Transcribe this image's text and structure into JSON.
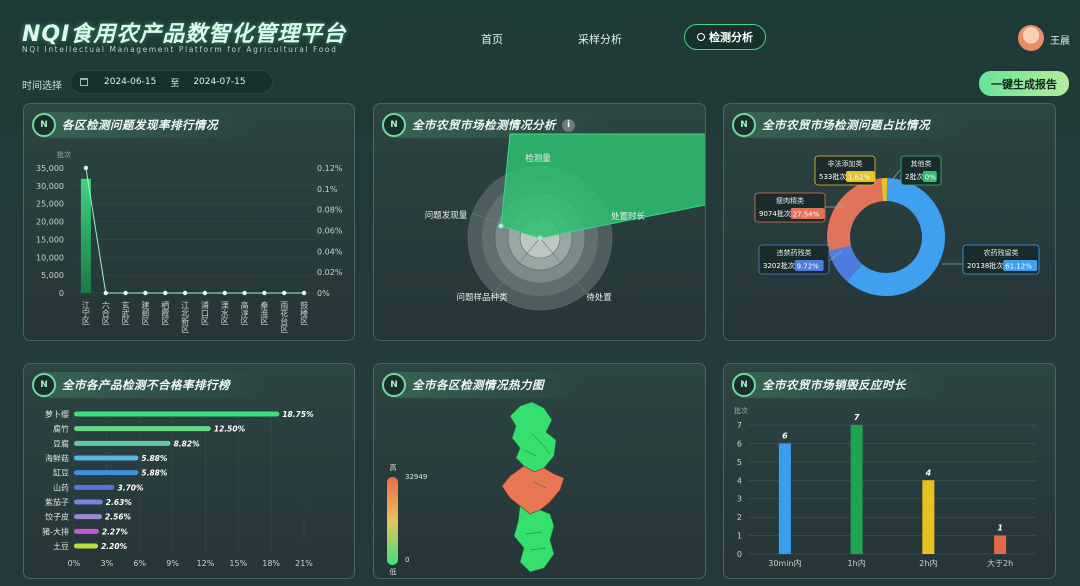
{
  "header": {
    "title": "NQI食用农产品数智化管理平台",
    "subtitle": "NQI Intellectual Management Platform for Agricultural Food",
    "nav": [
      {
        "label": "首页"
      },
      {
        "label": "采样分析"
      },
      {
        "label": "检测分析"
      }
    ],
    "user": "王晨",
    "time_label": "时间选择",
    "date_from": "2024-06-15",
    "date_sep": "至",
    "date_to": "2024-07-15",
    "report_button": "一键生成报告"
  },
  "panels": {
    "p1": "各区检测问题发现率排行情况",
    "p2": "全市农贸市场检测情况分析",
    "p3": "全市农贸市场检测问题占比情况",
    "p4": "全市各产品检测不合格率排行榜",
    "p5": "全市各区检测情况热力图",
    "p6": "全市农贸市场销毁反应时长"
  },
  "icons": {
    "panel_logo": "nqi-logo-icon",
    "calendar": "calendar-icon",
    "search": "search-icon",
    "info": "info-icon"
  },
  "chart_data": [
    {
      "type": "bar+line",
      "unit": "批次",
      "categories": [
        "江宁区",
        "六合区",
        "玄武区",
        "建邺区",
        "栖霞区",
        "江北新区",
        "浦口区",
        "溧水区",
        "高淳区",
        "秦淮区",
        "雨花台区",
        "鼓楼区"
      ],
      "series": [
        {
          "values": [
            32000,
            0,
            0,
            0,
            0,
            0,
            0,
            0,
            0,
            0,
            0,
            0
          ]
        },
        {
          "values": [
            0.12,
            0,
            0,
            0,
            0,
            0,
            0,
            0,
            0,
            0,
            0,
            0
          ]
        }
      ],
      "y_left_ticks": [
        "0",
        "5,000",
        "10,000",
        "15,000",
        "20,000",
        "25,000",
        "30,000",
        "35,000"
      ],
      "y_right_ticks": [
        "0%",
        "0.02%",
        "0.04%",
        "0.06%",
        "0.08%",
        "0.1%",
        "0.12%"
      ],
      "ylim_left": [
        0,
        35000
      ],
      "ylim_right": [
        0,
        0.12
      ]
    },
    {
      "type": "radar",
      "indicators": [
        "检测量",
        "处置时长",
        "待处置",
        "问题样品种类",
        "问题发现量"
      ],
      "values": [
        1,
        0.85,
        0.05,
        0.05,
        0.3
      ],
      "colors": {
        "area": "#2fbf71"
      }
    },
    {
      "type": "pie",
      "slices": [
        {
          "name": "农药残留类",
          "value": "20138批次",
          "pct": "61.12%",
          "n": 20138,
          "color": "#3fa0f0"
        },
        {
          "name": "违禁药残类",
          "value": "3202批次",
          "pct": "9.72%",
          "n": 3202,
          "color": "#4e7de0"
        },
        {
          "name": "瘦肉精类",
          "value": "9074批次",
          "pct": "27.54%",
          "n": 9074,
          "color": "#e0735a"
        },
        {
          "name": "非法添加类",
          "value": "533批次",
          "pct": "1.62%",
          "n": 533,
          "color": "#e8c22a"
        },
        {
          "name": "其他类",
          "value": "2批次",
          "pct": "0%",
          "n": 2,
          "color": "#2fbf71"
        }
      ]
    },
    {
      "type": "bar",
      "orientation": "horizontal",
      "categories": [
        "萝卜缨",
        "腐竹",
        "豆腐",
        "海鲜菇",
        "缸豆",
        "山药",
        "紫茄子",
        "饺子皮",
        "猪-大排",
        "土豆"
      ],
      "values": [
        18.75,
        12.5,
        8.82,
        5.88,
        5.88,
        3.7,
        2.63,
        2.56,
        2.27,
        2.2
      ],
      "labels": [
        "18.75%",
        "12.50%",
        "8.82%",
        "5.88%",
        "5.88%",
        "3.70%",
        "2.63%",
        "2.56%",
        "2.27%",
        "2.20%"
      ],
      "xticks": [
        "0%",
        "3%",
        "6%",
        "9%",
        "12%",
        "15%",
        "18%",
        "21%"
      ],
      "xlim": [
        0,
        21
      ],
      "colors": [
        "#3ee07d",
        "#66d88a",
        "#5ec9a4",
        "#55b8e0",
        "#3d8fe0",
        "#5573d8",
        "#7b83d8",
        "#9c8ad0",
        "#c05ad6",
        "#b6e040"
      ]
    },
    {
      "type": "heatmap",
      "legend_high": "高",
      "legend_low": "低",
      "max_label": "32949",
      "min_label": "0"
    },
    {
      "type": "bar",
      "ylabel": "批次",
      "categories": [
        "30min内",
        "1h内",
        "2h内",
        "大于2h"
      ],
      "values": [
        6,
        7,
        4,
        1
      ],
      "labels": [
        "6",
        "7",
        "4",
        "1"
      ],
      "yticks": [
        "0",
        "1",
        "2",
        "3",
        "4",
        "5",
        "6",
        "7"
      ],
      "ylim": [
        0,
        7
      ],
      "colors": [
        "#3a9ef0",
        "#1ea453",
        "#e8c21f",
        "#e4694a"
      ]
    }
  ]
}
